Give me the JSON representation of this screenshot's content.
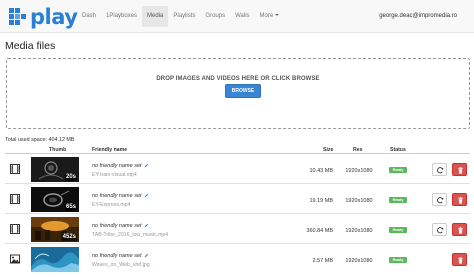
{
  "app": {
    "logo_text": "play"
  },
  "nav": {
    "items": [
      {
        "label": "Dash",
        "active": false
      },
      {
        "label": "1Playboxes",
        "active": false
      },
      {
        "label": "Media",
        "active": true
      },
      {
        "label": "Playlists",
        "active": false
      },
      {
        "label": "Groups",
        "active": false
      },
      {
        "label": "Walls",
        "active": false
      },
      {
        "label": "More",
        "active": false
      }
    ],
    "user_email": "george.deac@impromedia.ro"
  },
  "page": {
    "title": "Media files"
  },
  "dropzone": {
    "text": "DROP IMAGES AND VIDEOS HERE OR CLICK BROWSE",
    "button_label": "BROWSE"
  },
  "total_space": "Total used space: 404.12 MB",
  "table": {
    "headers": {
      "thumb": "Thumb",
      "friendly_name": "Friendly name",
      "size": "Size",
      "res": "Res",
      "status": "Status"
    },
    "rows": [
      {
        "type_icon": "film-icon",
        "duration": "20s",
        "friendly_name": "no friendly name set",
        "filename": "EY-train-visual.mp4",
        "size": "10.43 MB",
        "res": "1920x1080",
        "status": "Ready"
      },
      {
        "type_icon": "film-icon",
        "duration": "65s",
        "friendly_name": "no friendly name set",
        "filename": "EY-Express.mp4",
        "size": "19.19 MB",
        "res": "1920x1080",
        "status": "Ready"
      },
      {
        "type_icon": "film-icon",
        "duration": "452s",
        "friendly_name": "no friendly name set",
        "filename": "TAB-Tribe_2016_low_music.mp4",
        "size": "360.84 MB",
        "res": "1920x1080",
        "status": "Ready"
      },
      {
        "type_icon": "image-icon",
        "duration": "",
        "friendly_name": "no friendly name set",
        "filename": "Waves_on_Web_uhd.jpg",
        "size": "2.57 MB",
        "res": "1920x1080",
        "status": "Ready"
      }
    ]
  },
  "colors": {
    "brand": "#2a7fd4",
    "ready_badge": "#5cb85c",
    "delete_button": "#d9534f",
    "browse_button": "#3a84d6"
  }
}
